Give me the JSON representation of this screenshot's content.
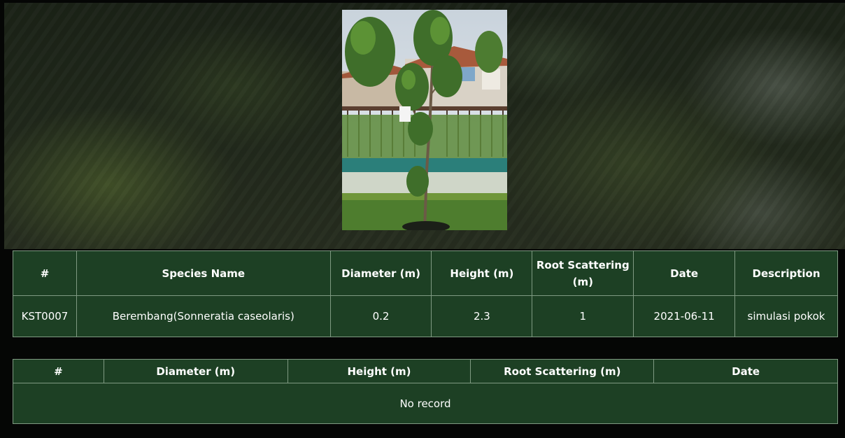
{
  "tree_table": {
    "headers": [
      "#",
      "Species Name",
      "Diameter (m)",
      "Height (m)",
      "Root Scattering (m)",
      "Date",
      "Description"
    ],
    "row": {
      "id": "KST0007",
      "species": "Berembang(Sonneratia caseolaris)",
      "diameter": "0.2",
      "height": "2.3",
      "root_scattering": "1",
      "date": "2021-06-11",
      "description": "simulasi pokok"
    }
  },
  "history_table": {
    "headers": [
      "#",
      "Diameter (m)",
      "Height (m)",
      "Root Scattering (m)",
      "Date"
    ],
    "empty_message": "No record"
  },
  "colors": {
    "table_bg": "#1d4024",
    "table_border": "#7f9a82",
    "page_bg": "#050605"
  }
}
